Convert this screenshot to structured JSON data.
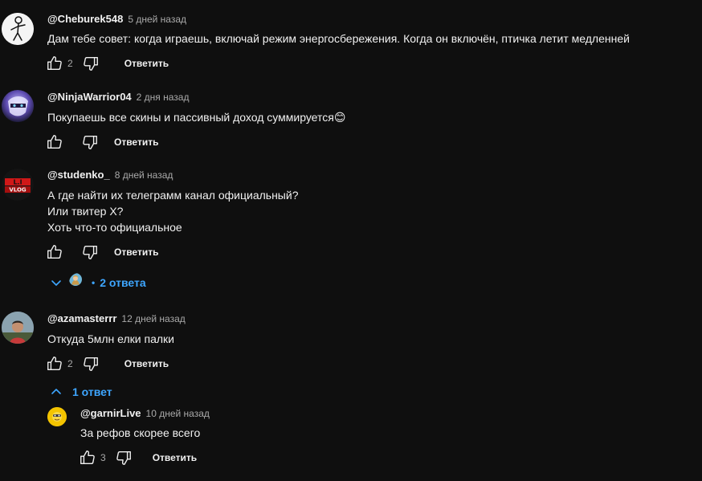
{
  "comments": [
    {
      "author": "@Cheburek548",
      "time": "5 дней назад",
      "lines": [
        "Дам тебе совет: когда играешь, включай режим энергосбережения. Когда он включён, птичка летит медленней"
      ],
      "likes": "2",
      "reply_label": "Ответить",
      "avatar_icon": "stick-figure-avatar"
    },
    {
      "author": "@NinjaWarrior04",
      "time": "2 дня назад",
      "lines": [
        "Покупаешь все скины и пассивный доход суммируется😊"
      ],
      "likes": "",
      "reply_label": "Ответить",
      "avatar_icon": "ninja-avatar"
    },
    {
      "author": "@studenko_",
      "time": "8 дней назад",
      "lines": [
        "А где найти их телеграмм канал официальный?",
        "Или твитер X?",
        "Хоть что-то официальное"
      ],
      "likes": "",
      "reply_label": "Ответить",
      "avatar_icon": "vlog-logo-avatar",
      "avatar_text": "L.I VLOG",
      "replies_label": "2 ответа"
    },
    {
      "author": "@azamasterrr",
      "time": "12 дней назад",
      "lines": [
        "Откуда 5млн елки палки"
      ],
      "likes": "2",
      "reply_label": "Ответить",
      "avatar_icon": "photo-avatar",
      "replies_label": "1 ответ"
    }
  ],
  "reply": {
    "author": "@garnirLive",
    "time": "10 дней назад",
    "text": "За рефов скорее всего",
    "likes": "3",
    "reply_label": "Ответить",
    "avatar_icon": "yellow-character-avatar"
  },
  "colors": {
    "background": "#0f0f0f",
    "text": "#f1f1f1",
    "secondary": "#aaaaaa",
    "link_blue": "#3ea6ff"
  }
}
